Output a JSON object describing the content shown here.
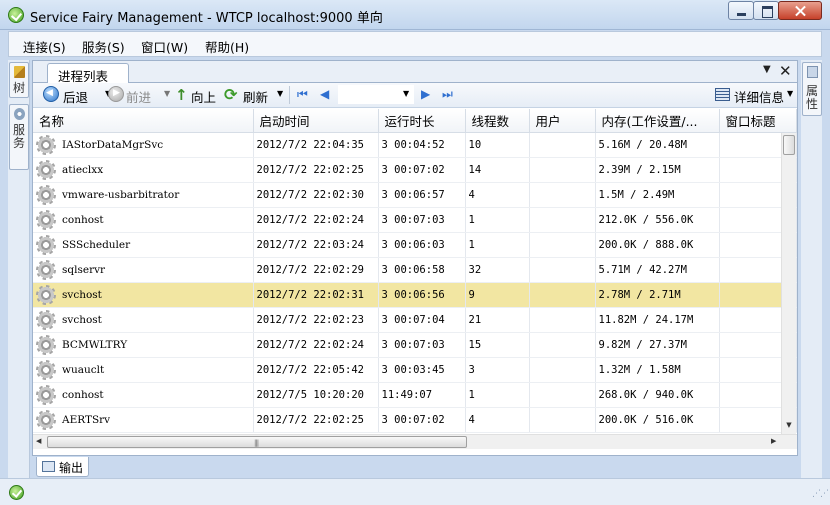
{
  "window": {
    "title": "Service Fairy Management - WTCP localhost:9000 单向"
  },
  "menu": {
    "items": [
      "连接(S)",
      "服务(S)",
      "窗口(W)",
      "帮助(H)"
    ]
  },
  "side_left": {
    "tabs": [
      "树",
      "服务"
    ]
  },
  "side_right": {
    "tabs": [
      "属性"
    ]
  },
  "document": {
    "tab_label": "进程列表"
  },
  "toolbar": {
    "back": "后退",
    "forward": "前进",
    "up": "向上",
    "refresh": "刷新",
    "details": "详细信息"
  },
  "table": {
    "columns": [
      "名称",
      "启动时间",
      "运行时长",
      "线程数",
      "用户",
      "内存(工作设置/...",
      "窗口标题"
    ],
    "selected_row": 6,
    "rows": [
      [
        "IAStorDataMgrSvc",
        "2012/7/2 22:04:35",
        "3 00:04:52",
        "10",
        "",
        "5.16M / 20.48M",
        ""
      ],
      [
        "atieclxx",
        "2012/7/2 22:02:25",
        "3 00:07:02",
        "14",
        "",
        "2.39M / 2.15M",
        ""
      ],
      [
        "vmware-usbarbitrator",
        "2012/7/2 22:02:30",
        "3 00:06:57",
        "4",
        "",
        "1.5M / 2.49M",
        ""
      ],
      [
        "conhost",
        "2012/7/2 22:02:24",
        "3 00:07:03",
        "1",
        "",
        "212.0K / 556.0K",
        ""
      ],
      [
        "SSScheduler",
        "2012/7/2 22:03:24",
        "3 00:06:03",
        "1",
        "",
        "200.0K / 888.0K",
        ""
      ],
      [
        "sqlservr",
        "2012/7/2 22:02:29",
        "3 00:06:58",
        "32",
        "",
        "5.71M / 42.27M",
        ""
      ],
      [
        "svchost",
        "2012/7/2 22:02:31",
        "3 00:06:56",
        "9",
        "",
        "2.78M / 2.71M",
        ""
      ],
      [
        "svchost",
        "2012/7/2 22:02:23",
        "3 00:07:04",
        "21",
        "",
        "11.82M / 24.17M",
        ""
      ],
      [
        "BCMWLTRY",
        "2012/7/2 22:02:24",
        "3 00:07:03",
        "15",
        "",
        "9.82M / 27.37M",
        ""
      ],
      [
        "wuauclt",
        "2012/7/2 22:05:42",
        "3 00:03:45",
        "3",
        "",
        "1.32M / 1.58M",
        ""
      ],
      [
        "conhost",
        "2012/7/5 10:20:20",
        "11:49:07",
        "1",
        "",
        "268.0K / 940.0K",
        ""
      ],
      [
        "AERTSrv",
        "2012/7/2 22:02:25",
        "3 00:07:02",
        "4",
        "",
        "200.0K / 516.0K",
        ""
      ]
    ]
  },
  "output_panel": {
    "tab_label": "输出"
  }
}
